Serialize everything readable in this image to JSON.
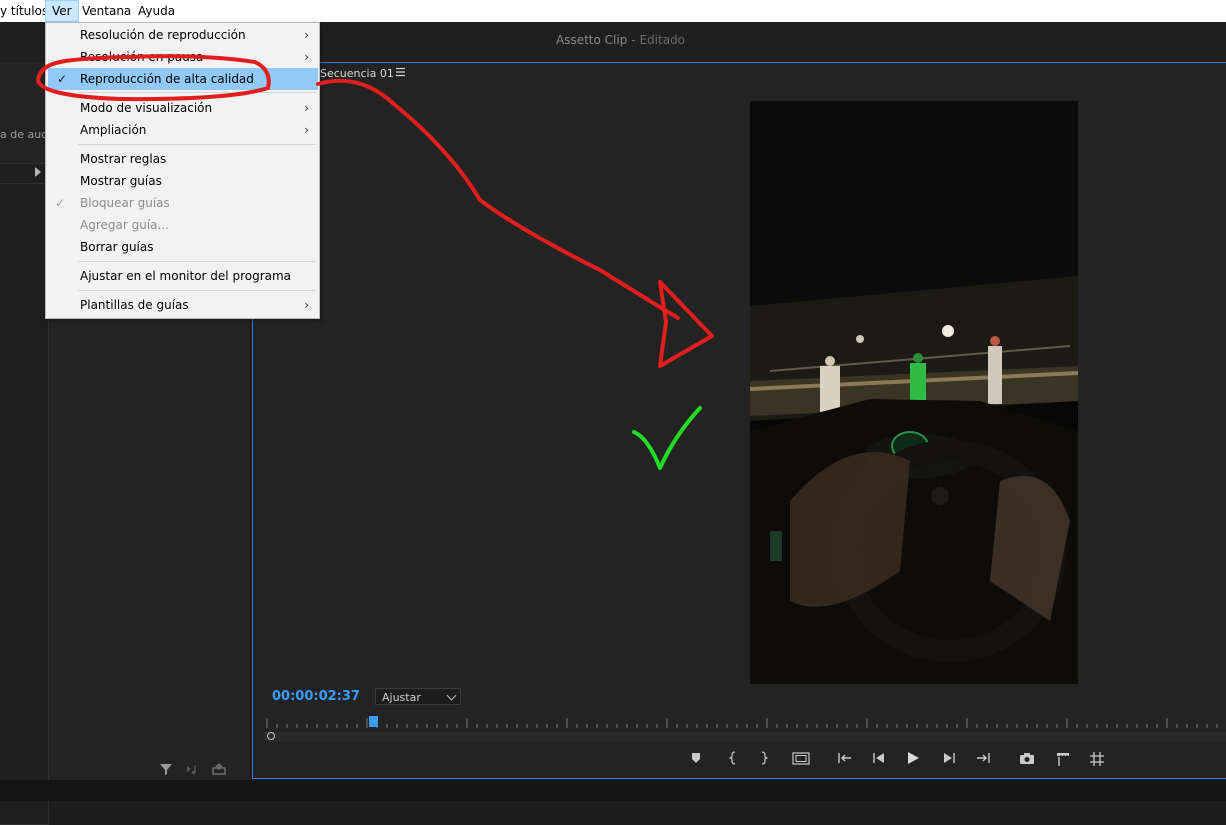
{
  "menubar": {
    "items": [
      {
        "label": "y títulos"
      },
      {
        "label": "Ver"
      },
      {
        "label": "Ventana"
      },
      {
        "label": "Ayuda"
      }
    ]
  },
  "app": {
    "title": "Assetto Clip",
    "status": "- Editado"
  },
  "left_panel": {
    "tab_label": "a de aud"
  },
  "view_menu": {
    "items": [
      {
        "label": "Resolución de reproducción",
        "submenu": true
      },
      {
        "label": "Resolución en pausa",
        "submenu": true
      },
      {
        "label": "Reproducción de alta calidad",
        "checked": true,
        "highlighted": true
      },
      {
        "label": "Modo de visualización",
        "submenu": true
      },
      {
        "label": "Ampliación",
        "submenu": true
      },
      {
        "label": "Mostrar reglas"
      },
      {
        "label": "Mostrar guías"
      },
      {
        "label": "Bloquear guías",
        "checked": true,
        "disabled": true
      },
      {
        "label": "Agregar guía...",
        "disabled": true
      },
      {
        "label": "Borrar guías"
      },
      {
        "label": "Ajustar en el monitor del programa"
      },
      {
        "label": "Plantillas de guías",
        "submenu": true
      }
    ]
  },
  "program_monitor": {
    "sequence_title": "Secuencia 01",
    "timecode": "00:00:02:37",
    "fit_select": "Ajustar",
    "playhead_position": 0.11
  },
  "icons": {
    "menu": "hamburger-menu-icon",
    "check": "checkmark-icon",
    "submenu": "chevron-right-icon"
  },
  "colors": {
    "accent": "#3b9cff",
    "highlight": "#91c9f7",
    "annotation_red": "#e01e1e",
    "annotation_green": "#22dd22"
  }
}
